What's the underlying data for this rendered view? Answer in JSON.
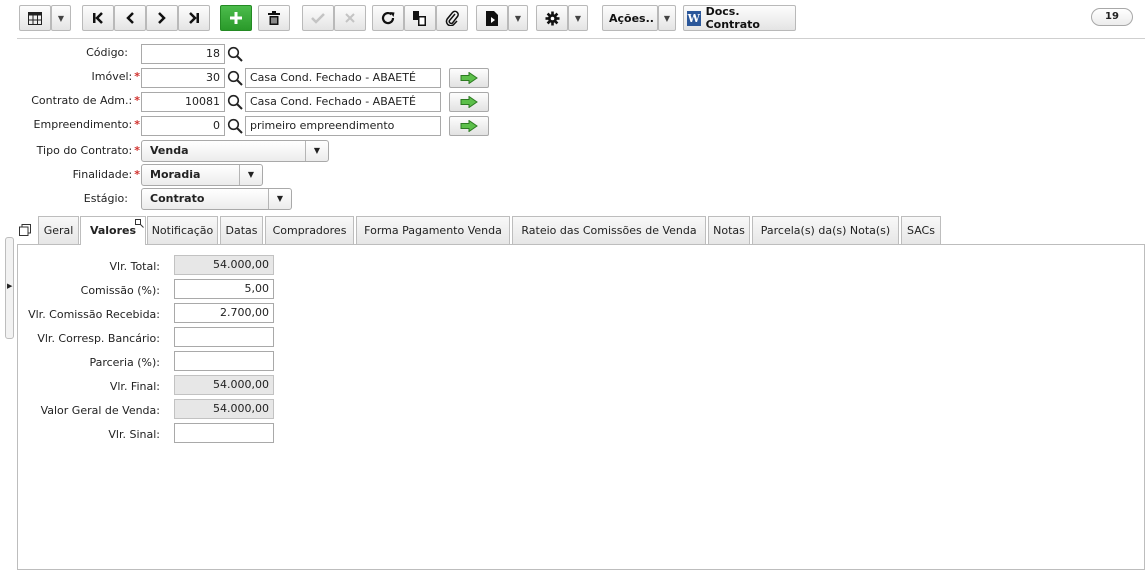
{
  "toolbar": {
    "acoes_label": "Ações..",
    "docs_contrato_label": "Docs. Contrato",
    "word_icon_letter": "W",
    "counter": "19"
  },
  "form": {
    "codigo": {
      "label": "Código:",
      "value": "18"
    },
    "imovel": {
      "label": "Imóvel:",
      "code": "30",
      "description": "Casa Cond. Fechado - ABAETÉ"
    },
    "contrato_adm": {
      "label": "Contrato de Adm.:",
      "code": "10081",
      "description": "Casa Cond. Fechado - ABAETÉ"
    },
    "empreendimento": {
      "label": "Empreendimento:",
      "code": "0",
      "description": "primeiro empreendimento"
    },
    "tipo_contrato": {
      "label": "Tipo do Contrato:",
      "value": "Venda"
    },
    "finalidade": {
      "label": "Finalidade:",
      "value": "Moradia"
    },
    "estagio": {
      "label": "Estágio:",
      "value": "Contrato"
    },
    "required_mark": "*"
  },
  "tabs": [
    {
      "label": "Geral"
    },
    {
      "label": "Valores",
      "active": true
    },
    {
      "label": "Notificação"
    },
    {
      "label": "Datas"
    },
    {
      "label": "Compradores"
    },
    {
      "label": "Forma Pagamento Venda"
    },
    {
      "label": "Rateio das Comissões de Venda"
    },
    {
      "label": "Notas"
    },
    {
      "label": "Parcela(s) da(s) Nota(s)"
    },
    {
      "label": "SACs"
    }
  ],
  "valores": [
    {
      "label": "Vlr. Total:",
      "value": "54.000,00",
      "readonly": true
    },
    {
      "label": "Comissão (%):",
      "value": "5,00",
      "readonly": false
    },
    {
      "label": "Vlr. Comissão Recebida:",
      "value": "2.700,00",
      "readonly": false
    },
    {
      "label": "Vlr. Corresp. Bancário:",
      "value": "",
      "readonly": false
    },
    {
      "label": "Parceria (%):",
      "value": "",
      "readonly": false
    },
    {
      "label": "Vlr. Final:",
      "value": "54.000,00",
      "readonly": true
    },
    {
      "label": "Valor Geral de Venda:",
      "value": "54.000,00",
      "readonly": true
    },
    {
      "label": "Vlr. Sinal:",
      "value": "",
      "readonly": false
    }
  ],
  "icons": {
    "grid": "grid-icon",
    "first": "first-record-icon",
    "prev": "previous-record-icon",
    "next": "next-record-icon",
    "last": "last-record-icon",
    "add": "add-icon",
    "delete": "trash-icon",
    "confirm": "check-icon",
    "cancel": "close-icon",
    "refresh": "refresh-icon",
    "duplicate": "duplicate-icon",
    "attach": "paperclip-icon",
    "report": "report-icon",
    "settings": "gear-icon",
    "search": "search-icon",
    "go": "arrow-right-icon"
  },
  "colors": {
    "go_arrow": "#4caf50",
    "add_button": "#2a9a2a",
    "required": "#d0312d",
    "readonly_bg": "#e7e7e7"
  }
}
